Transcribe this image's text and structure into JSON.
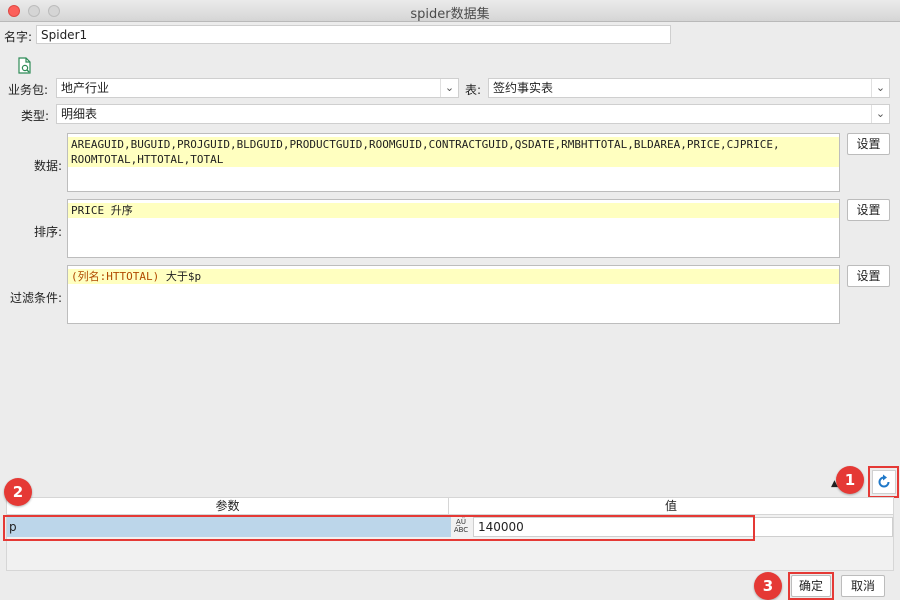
{
  "window": {
    "title": "spider数据集"
  },
  "name_field": {
    "label": "名字:",
    "value": "Spider1"
  },
  "toolbar": {
    "preview_icon": "search-document-icon"
  },
  "business_pack": {
    "label": "业务包:",
    "value": "地产行业"
  },
  "table": {
    "label": "表:",
    "value": "签约事实表"
  },
  "type": {
    "label": "类型:",
    "value": "明细表"
  },
  "data": {
    "label": "数据:",
    "lines": [
      "AREAGUID,BUGUID,PROJGUID,BLDGUID,PRODUCTGUID,ROOMGUID,CONTRACTGUID,QSDATE,RMBHTTOTAL,BLDAREA,PRICE,CJPRICE,",
      "ROOMTOTAL,HTTOTAL,TOTAL"
    ],
    "settings_label": "设置"
  },
  "sort": {
    "label": "排序:",
    "lines": [
      "PRICE 升序"
    ],
    "settings_label": "设置"
  },
  "filter": {
    "label": "过滤条件:",
    "line_prefix": "(列名:HTTOTAL)",
    "line_suffix": " 大于$p",
    "settings_label": "设置"
  },
  "refresh": {
    "icon": "refresh-icon"
  },
  "params_table": {
    "columns": [
      "参数",
      "值"
    ],
    "rows": [
      {
        "param": "p",
        "value": "140000",
        "type_icon": "ABC"
      }
    ]
  },
  "annotations": {
    "badge1": "1",
    "badge2": "2",
    "badge3": "3"
  },
  "footer": {
    "ok_label": "确定",
    "cancel_label": "取消"
  },
  "colors": {
    "highlight": "#ffffc0",
    "annotation_red": "#e53935",
    "selected_row": "#bcd6ea"
  }
}
